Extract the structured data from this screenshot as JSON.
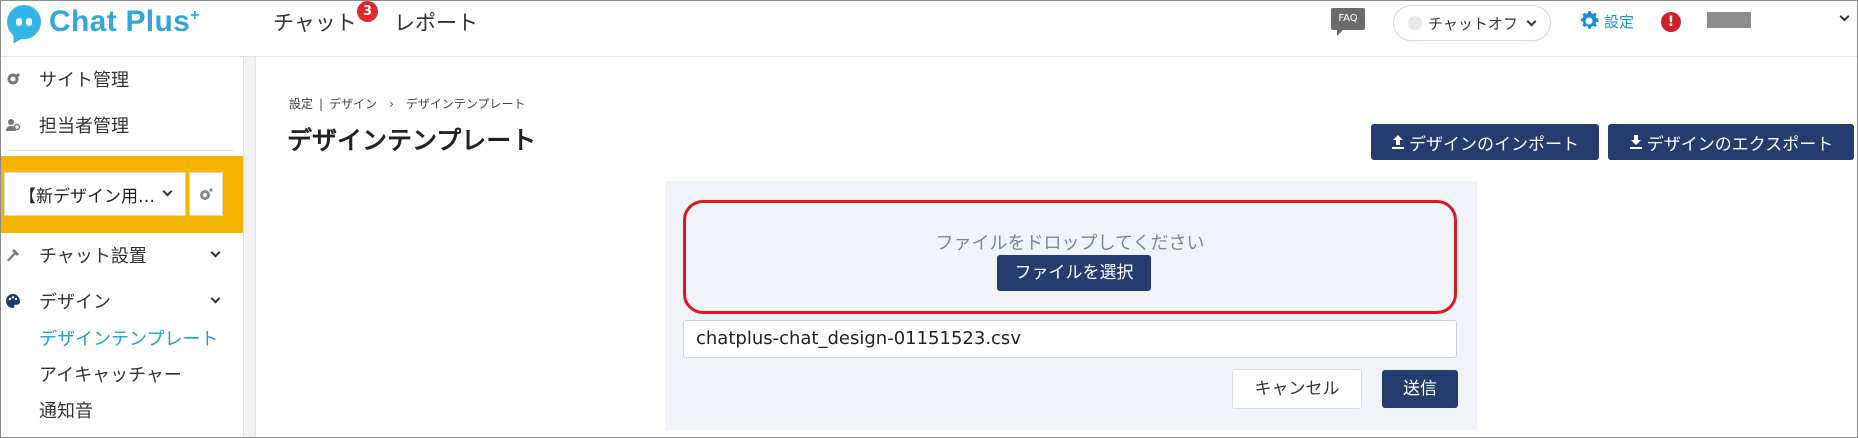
{
  "app": {
    "logo_text": "Chat Plus",
    "logo_plus": "+",
    "colors": {
      "brand": "#33a7dc",
      "navy": "#253d6e",
      "highlight": "#f5b400",
      "drop_border": "#e3161a",
      "active_link": "#1aa0dc"
    }
  },
  "header": {
    "nav": [
      {
        "label": "チャット",
        "badge": "3"
      },
      {
        "label": "レポート"
      }
    ],
    "faq_label": "FAQ",
    "chat_status": "チャットオフ",
    "settings_label": "設定",
    "alert_label": "!"
  },
  "sidebar": {
    "items": [
      {
        "label": "サイト管理",
        "icon": "gear-icon"
      },
      {
        "label": "担当者管理",
        "icon": "users-icon"
      }
    ],
    "site_select_value": "【新デザイン用…",
    "sections": [
      {
        "label": "チャット設置",
        "icon": "tools-icon"
      },
      {
        "label": "デザイン",
        "icon": "palette-icon"
      }
    ],
    "sub_items": [
      {
        "label": "デザインテンプレート",
        "active": true
      },
      {
        "label": "アイキャッチャー"
      },
      {
        "label": "通知音"
      }
    ]
  },
  "main": {
    "breadcrumb": [
      "設定",
      "デザイン",
      "デザインテンプレート"
    ],
    "breadcrumb_sep1": "|",
    "breadcrumb_sep2": "›",
    "title": "デザインテンプレート",
    "import_label": "デザインのインポート",
    "export_label": "デザインのエクスポート",
    "drop_text": "ファイルをドロップしてください",
    "choose_file_label": "ファイルを選択",
    "file_name": "chatplus-chat_design-01151523.csv",
    "cancel_label": "キャンセル",
    "submit_label": "送信"
  }
}
